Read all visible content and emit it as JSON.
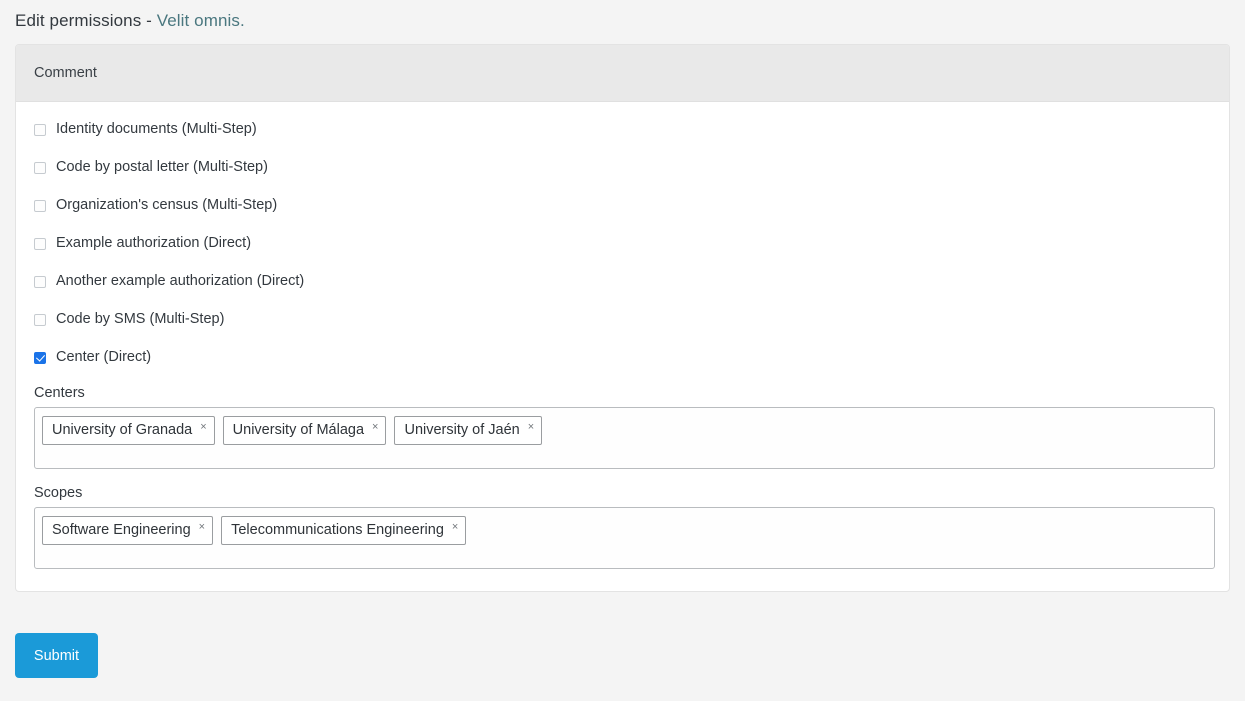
{
  "page": {
    "title_prefix": "Edit permissions - ",
    "title_link": "Velit omnis."
  },
  "panel": {
    "heading": "Comment"
  },
  "permissions": [
    {
      "label": "Identity documents (Multi-Step)",
      "checked": false
    },
    {
      "label": "Code by postal letter (Multi-Step)",
      "checked": false
    },
    {
      "label": "Organization's census (Multi-Step)",
      "checked": false
    },
    {
      "label": "Example authorization (Direct)",
      "checked": false
    },
    {
      "label": "Another example authorization (Direct)",
      "checked": false
    },
    {
      "label": "Code by SMS (Multi-Step)",
      "checked": false
    },
    {
      "label": "Center (Direct)",
      "checked": true
    }
  ],
  "centers": {
    "label": "Centers",
    "tags": [
      "University of Granada",
      "University of Málaga",
      "University of Jaén"
    ],
    "remove_glyph": "×"
  },
  "scopes": {
    "label": "Scopes",
    "tags": [
      "Software Engineering",
      "Telecommunications Engineering"
    ],
    "remove_glyph": "×"
  },
  "footer": {
    "submit_label": "Submit"
  },
  "colors": {
    "page_background": "#f4f4f4",
    "panel_heading": "#e9e9e9",
    "link": "#4a777f",
    "checkbox_checked": "#1a73e8",
    "submit_button": "#1b9ad8"
  }
}
